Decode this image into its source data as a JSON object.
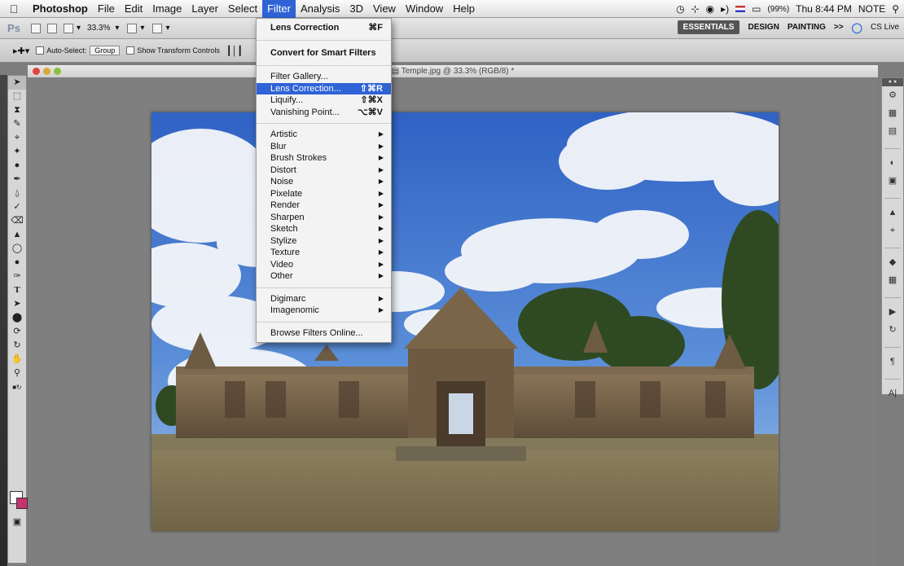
{
  "menubar": {
    "app_name": "Photoshop",
    "items": [
      "File",
      "Edit",
      "Image",
      "Layer",
      "Select",
      "Filter",
      "Analysis",
      "3D",
      "View",
      "Window",
      "Help"
    ],
    "status": {
      "battery": "(99%)",
      "clock": "Thu 8:44 PM",
      "user": "NOTE"
    }
  },
  "appbar": {
    "zoom": "33.3%",
    "workspaces": [
      "ESSENTIALS",
      "DESIGN",
      "PAINTING"
    ],
    "more": ">>",
    "cslive": "CS Live"
  },
  "options": {
    "auto_select_label": "Auto-Select:",
    "auto_select_value": "Group",
    "transform_label": "Show Transform Controls"
  },
  "document": {
    "title": "Temple.jpg @ 33.3% (RGB/8) *"
  },
  "filter_menu": {
    "last_filter": {
      "label": "Lens Correction",
      "shortcut": "⌘F"
    },
    "convert": "Convert for Smart Filters",
    "gallery": "Filter Gallery...",
    "lens": {
      "label": "Lens Correction...",
      "shortcut": "⇧⌘R"
    },
    "liquify": {
      "label": "Liquify...",
      "shortcut": "⇧⌘X"
    },
    "vanishing": {
      "label": "Vanishing Point...",
      "shortcut": "⌥⌘V"
    },
    "submenus": [
      "Artistic",
      "Blur",
      "Brush Strokes",
      "Distort",
      "Noise",
      "Pixelate",
      "Render",
      "Sharpen",
      "Sketch",
      "Stylize",
      "Texture",
      "Video",
      "Other"
    ],
    "plugins": [
      "Digimarc",
      "Imagenomic"
    ],
    "browse": "Browse Filters Online..."
  }
}
